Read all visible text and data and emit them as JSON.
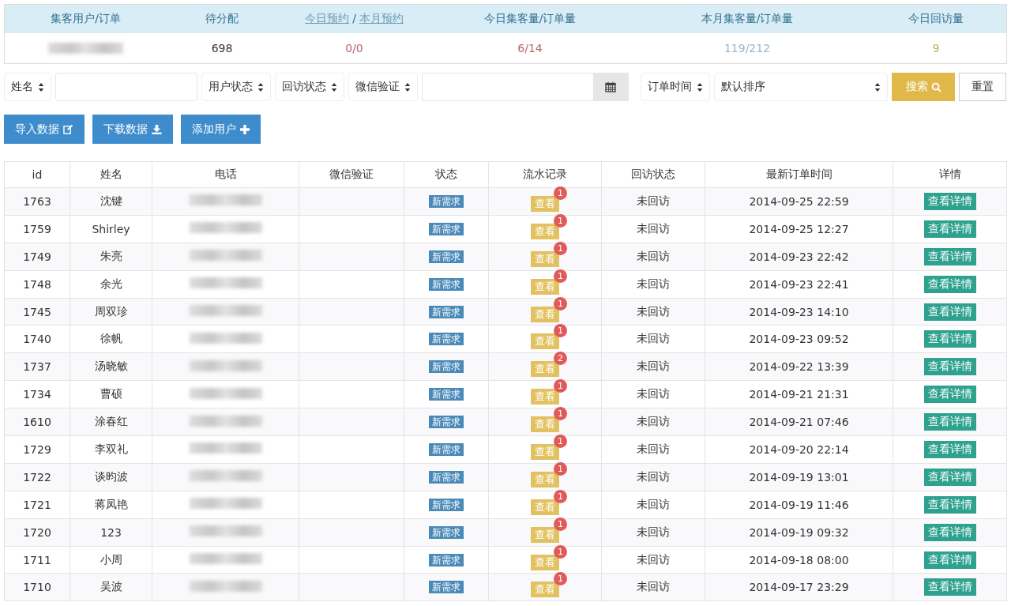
{
  "summary": {
    "columns": [
      {
        "kind": "label",
        "label": "集客用户/订单"
      },
      {
        "kind": "label",
        "label": "待分配"
      },
      {
        "kind": "links",
        "links": [
          "今日预约",
          "本月预约"
        ],
        "separator": "/"
      },
      {
        "kind": "label",
        "label": "今日集客量/订单量"
      },
      {
        "kind": "label",
        "label": "本月集客量/订单量"
      },
      {
        "kind": "label",
        "label": "今日回访量"
      }
    ],
    "values": [
      {
        "kind": "blurred"
      },
      {
        "kind": "text",
        "text": "698",
        "color": "#333333"
      },
      {
        "kind": "text",
        "text": "0/0",
        "color": "#b5676a"
      },
      {
        "kind": "text",
        "text": "6/14",
        "color": "#b5676a"
      },
      {
        "kind": "text",
        "text": "119/212",
        "color": "#9db6c7"
      },
      {
        "kind": "text",
        "text": "9",
        "color": "#b8b45a"
      }
    ]
  },
  "filters": [
    {
      "kind": "select",
      "label": "姓名"
    },
    {
      "kind": "input"
    },
    {
      "kind": "select",
      "label": "用户状态"
    },
    {
      "kind": "select",
      "label": "回访状态"
    },
    {
      "kind": "select",
      "label": "微信验证"
    },
    {
      "kind": "date"
    },
    {
      "kind": "select",
      "label": "订单时间"
    },
    {
      "kind": "wide-select",
      "label": "默认排序"
    },
    {
      "kind": "search",
      "label": "搜索"
    },
    {
      "kind": "reset",
      "label": "重置"
    }
  ],
  "actions": [
    {
      "label": "导入数据",
      "kind": "edit"
    },
    {
      "label": "下载数据",
      "kind": "download"
    },
    {
      "label": "添加用户",
      "kind": "add"
    }
  ],
  "table": {
    "columns": [
      "id",
      "姓名",
      "电话",
      "微信验证",
      "状态",
      "流水记录",
      "回访状态",
      "最新订单时间",
      "详情"
    ],
    "rows": [
      {
        "id": "1763",
        "name": "沈键",
        "status": "新需求",
        "log": "查看",
        "count": "1",
        "visit": "未回访",
        "time": "2014-09-25 22:59",
        "detail": "查看详情"
      },
      {
        "id": "1759",
        "name": "Shirley",
        "status": "新需求",
        "log": "查看",
        "count": "1",
        "visit": "未回访",
        "time": "2014-09-25 12:27",
        "detail": "查看详情"
      },
      {
        "id": "1749",
        "name": "朱亮",
        "status": "新需求",
        "log": "查看",
        "count": "1",
        "visit": "未回访",
        "time": "2014-09-23 22:42",
        "detail": "查看详情"
      },
      {
        "id": "1748",
        "name": "余光",
        "status": "新需求",
        "log": "查看",
        "count": "1",
        "visit": "未回访",
        "time": "2014-09-23 22:41",
        "detail": "查看详情"
      },
      {
        "id": "1745",
        "name": "周双珍",
        "status": "新需求",
        "log": "查看",
        "count": "1",
        "visit": "未回访",
        "time": "2014-09-23 14:10",
        "detail": "查看详情"
      },
      {
        "id": "1740",
        "name": "徐帆",
        "status": "新需求",
        "log": "查看",
        "count": "1",
        "visit": "未回访",
        "time": "2014-09-23 09:52",
        "detail": "查看详情"
      },
      {
        "id": "1737",
        "name": "汤晓敏",
        "status": "新需求",
        "log": "查看",
        "count": "2",
        "visit": "未回访",
        "time": "2014-09-22 13:39",
        "detail": "查看详情"
      },
      {
        "id": "1734",
        "name": "曹硕",
        "status": "新需求",
        "log": "查看",
        "count": "1",
        "visit": "未回访",
        "time": "2014-09-21 21:31",
        "detail": "查看详情"
      },
      {
        "id": "1610",
        "name": "涂春红",
        "status": "新需求",
        "log": "查看",
        "count": "1",
        "visit": "未回访",
        "time": "2014-09-21 07:46",
        "detail": "查看详情"
      },
      {
        "id": "1729",
        "name": "李双礼",
        "status": "新需求",
        "log": "查看",
        "count": "1",
        "visit": "未回访",
        "time": "2014-09-20 22:14",
        "detail": "查看详情"
      },
      {
        "id": "1722",
        "name": "谈昀波",
        "status": "新需求",
        "log": "查看",
        "count": "1",
        "visit": "未回访",
        "time": "2014-09-19 13:01",
        "detail": "查看详情"
      },
      {
        "id": "1721",
        "name": "蒋凤艳",
        "status": "新需求",
        "log": "查看",
        "count": "1",
        "visit": "未回访",
        "time": "2014-09-19 11:46",
        "detail": "查看详情"
      },
      {
        "id": "1720",
        "name": "123",
        "status": "新需求",
        "log": "查看",
        "count": "1",
        "visit": "未回访",
        "time": "2014-09-19 09:32",
        "detail": "查看详情"
      },
      {
        "id": "1711",
        "name": "小周",
        "status": "新需求",
        "log": "查看",
        "count": "1",
        "visit": "未回访",
        "time": "2014-09-18 08:00",
        "detail": "查看详情"
      },
      {
        "id": "1710",
        "name": "吴波",
        "status": "新需求",
        "log": "查看",
        "count": "1",
        "visit": "未回访",
        "time": "2014-09-17 23:29",
        "detail": "查看详情"
      }
    ]
  }
}
